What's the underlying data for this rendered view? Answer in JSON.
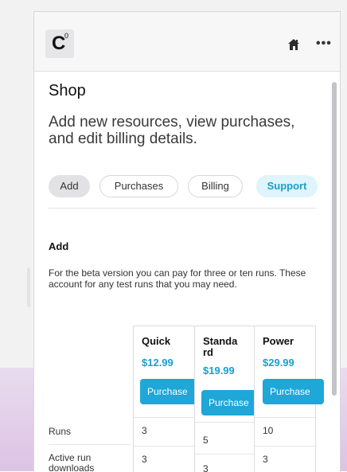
{
  "header": {
    "logo_letter": "C",
    "logo_mark": "0",
    "home_icon": "home-icon",
    "more_label": "•••"
  },
  "page": {
    "title": "Shop",
    "lead": "Add new resources, view purchases, and edit billing details."
  },
  "tabs": [
    {
      "label": "Add",
      "selected": true
    },
    {
      "label": "Purchases"
    },
    {
      "label": "Billing"
    },
    {
      "label": "Support",
      "accent": "#1a9fc8"
    }
  ],
  "section": {
    "title": "Add",
    "body": "For the beta version you can pay for three or ten runs. These account for any test runs that you may need."
  },
  "rows": [
    "Runs",
    "Active run downloads"
  ],
  "plans": [
    {
      "name": "Quick",
      "price": "$12.99",
      "button": "Purchase",
      "runs": "3",
      "active": "3"
    },
    {
      "name": "Standard",
      "price": "$19.99",
      "button": "Purchase",
      "runs": "5",
      "active": "3"
    },
    {
      "name": "Power",
      "price": "$29.99",
      "button": "Purchase",
      "runs": "10",
      "active": "3"
    }
  ],
  "colors": {
    "accent": "#1ea7d7",
    "price": "#1a9fc8",
    "support_bg": "#dff4fb"
  }
}
